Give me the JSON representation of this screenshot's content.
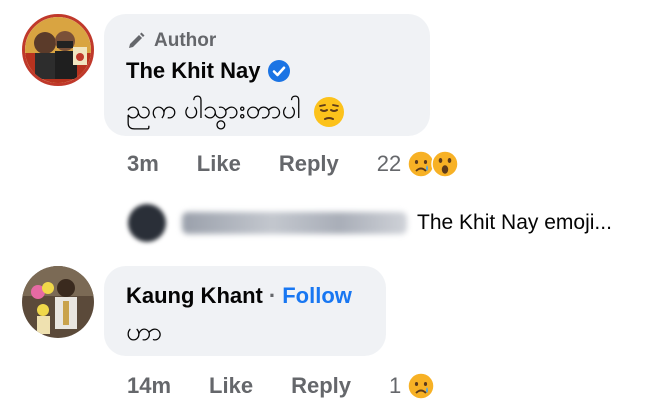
{
  "comment1": {
    "author_badge": "Author",
    "name": "The Khit Nay",
    "verified": true,
    "text": "ညက ပါသွားတာပါ",
    "text_emoji": "😔",
    "time": "3m",
    "like_label": "Like",
    "reply_label": "Reply",
    "reaction_count": "22",
    "reactions": [
      "sad-face",
      "wow-face"
    ]
  },
  "reply_preview": {
    "suffix": "The Khit Nay emoji..."
  },
  "comment2": {
    "name": "Kaung Khant",
    "separator": "·",
    "follow_label": "Follow",
    "text": "ဟာ",
    "time": "14m",
    "like_label": "Like",
    "reply_label": "Reply",
    "reaction_count": "1",
    "reactions": [
      "sad-face"
    ]
  },
  "colors": {
    "bubble": "#f0f2f5",
    "link_blue": "#1877f2",
    "secondary_text": "#65676b",
    "verified_blue": "#1b74e4"
  }
}
